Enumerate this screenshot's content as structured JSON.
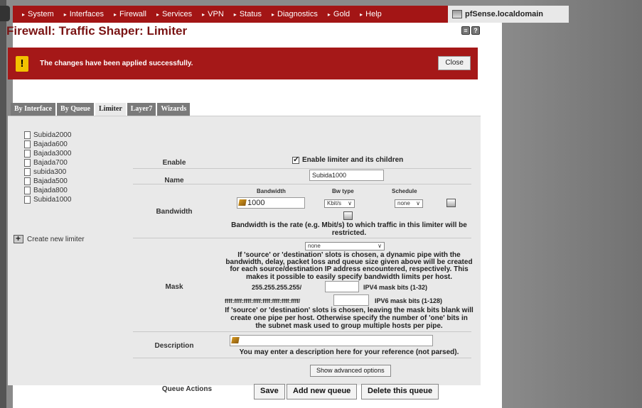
{
  "nav": {
    "items": [
      "System",
      "Interfaces",
      "Firewall",
      "Services",
      "VPN",
      "Status",
      "Diagnostics",
      "Gold",
      "Help"
    ],
    "hostname": "pfSense.localdomain"
  },
  "page": {
    "title": "Firewall: Traffic Shaper: Limiter"
  },
  "alert": {
    "message": "The changes have been applied successfully.",
    "close_label": "Close"
  },
  "tabs": [
    {
      "label": "By Interface",
      "active": false
    },
    {
      "label": "By Queue",
      "active": false
    },
    {
      "label": "Limiter",
      "active": true
    },
    {
      "label": "Layer7",
      "active": false
    },
    {
      "label": "Wizards",
      "active": false
    }
  ],
  "limiters": [
    "Subida2000",
    "Bajada600",
    "Bajada3000",
    "Bajada700",
    "subida300",
    "Bajada500",
    "Bajada800",
    "Subida1000"
  ],
  "create_limiter_label": "Create new limiter",
  "form": {
    "enable": {
      "label": "Enable",
      "checkbox_label": "Enable limiter and its children",
      "checked": true
    },
    "name": {
      "label": "Name",
      "value": "Subida1000"
    },
    "bandwidth": {
      "label": "Bandwidth",
      "col_bandwidth": "Bandwidth",
      "col_bwtype": "Bw type",
      "col_schedule": "Schedule",
      "value": "1000",
      "bwtype": "Kbit/s",
      "schedule": "none",
      "note_line1": "Bandwidth is the rate (e.g. Mbit/s) to which traffic in this limiter will be",
      "note_line2": "restricted."
    },
    "mask": {
      "label": "Mask",
      "select_value": "none",
      "desc_line1": "If 'source' or 'destination' slots is chosen, a dynamic pipe with the",
      "desc_line2": "bandwidth, delay, packet loss and queue size given above will be created",
      "desc_line3": "for each source/destination IP address encountered, respectively. This",
      "desc_line4": "makes it possible to easily specify bandwidth limits per host.",
      "ipv4_prefix": "255.255.255.255/",
      "ipv4_label": "IPV4 mask bits (1-32)",
      "ipv6_prefix": "ffff:ffff:ffff:ffff:ffff:ffff:ffff:ffff/",
      "ipv6_label": "IPV6 mask bits (1-128)",
      "note_line1": "If 'source' or 'destination' slots is chosen, leaving the mask bits blank will",
      "note_line2": "create one pipe per host. Otherwise specify the number of 'one' bits in",
      "note_line3": "the subnet mask used to group multiple hosts per pipe."
    },
    "description": {
      "label": "Description",
      "value": "",
      "note": "You may enter a description here for your reference (not parsed)."
    },
    "advanced_button": "Show advanced options",
    "queue_actions": {
      "label": "Queue Actions",
      "save": "Save",
      "add": "Add new queue",
      "delete": "Delete this queue"
    }
  },
  "colors": {
    "nav_red": "#a31515",
    "title_red": "#7a1414",
    "alert_red": "#a51818",
    "alert_icon_yellow": "#f2c200"
  }
}
